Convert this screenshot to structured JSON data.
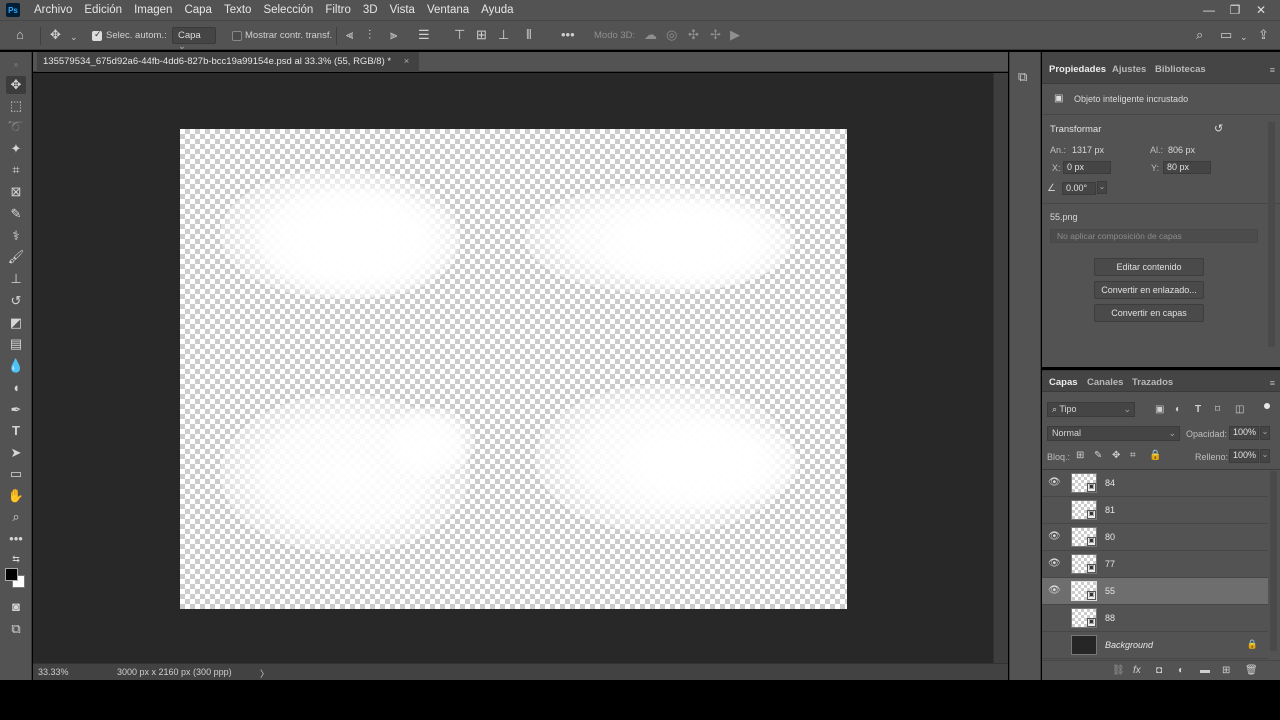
{
  "menubar": {
    "logo": "Ps",
    "items": [
      "Archivo",
      "Edición",
      "Imagen",
      "Capa",
      "Texto",
      "Selección",
      "Filtro",
      "3D",
      "Vista",
      "Ventana",
      "Ayuda"
    ],
    "win_minimize": "—",
    "win_restore": "❐",
    "win_close": "✕"
  },
  "options": {
    "auto_select_label": "Selec. autom.:",
    "auto_select_value": "Capa",
    "show_transform_label": "Mostrar contr. transf.",
    "mode_3d_label": "Modo 3D:",
    "more": "•••"
  },
  "document": {
    "tab_title": "135579534_675d92a6-44fb-4dd6-827b-bcc19a99154e.psd al 33.3% (55, RGB/8) *",
    "tab_close": "×",
    "zoom": "33.33%",
    "doc_info": "3000 px x 2160 px (300 ppp)",
    "status_arrow": "〉"
  },
  "properties": {
    "tabs": [
      "Propiedades",
      "Ajustes",
      "Bibliotecas"
    ],
    "object_type": "Objeto inteligente incrustado",
    "section_title": "Transformar",
    "width_label": "An.:",
    "width_value": "1317 px",
    "height_label": "Al.:",
    "height_value": "806 px",
    "x_label": "X:",
    "x_value": "0 px",
    "y_label": "Y:",
    "y_value": "80 px",
    "angle_value": "0.00°",
    "source_file": "55.png",
    "comp_placeholder": "No aplicar composición de capas",
    "buttons": [
      "Editar contenido",
      "Convertir en enlazado...",
      "Convertir en capas"
    ]
  },
  "layers_panel": {
    "tabs": [
      "Capas",
      "Canales",
      "Trazados"
    ],
    "filter_label": "Tipo",
    "blend_mode": "Normal",
    "opacity_label": "Opacidad:",
    "opacity_value": "100%",
    "lock_label": "Bloq.:",
    "fill_label": "Relleno:",
    "fill_value": "100%",
    "layers": [
      {
        "name": "84",
        "visible": true,
        "selected": false
      },
      {
        "name": "81",
        "visible": false,
        "selected": false
      },
      {
        "name": "80",
        "visible": true,
        "selected": false
      },
      {
        "name": "77",
        "visible": true,
        "selected": false
      },
      {
        "name": "55",
        "visible": true,
        "selected": true
      },
      {
        "name": "88",
        "visible": false,
        "selected": false
      },
      {
        "name": "Background",
        "visible": false,
        "selected": false,
        "locked": true
      }
    ],
    "footer_icons": [
      "link-icon",
      "fx-icon",
      "mask-icon",
      "adjustment-icon",
      "folder-icon",
      "new-layer-icon",
      "trash-icon"
    ]
  },
  "colors": {
    "panel_bg": "#535353",
    "canvas_bg": "#282828",
    "selected_row": "#6e6e6e"
  }
}
